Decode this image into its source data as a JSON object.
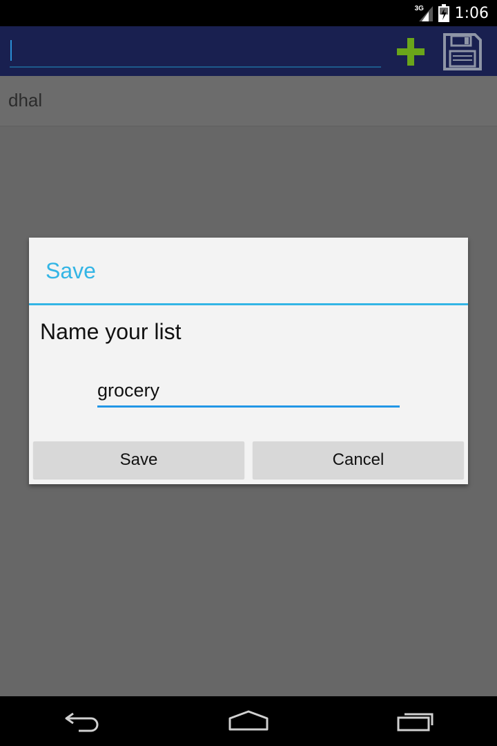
{
  "status_bar": {
    "time": "1:06",
    "network_label": "3G",
    "icons": [
      "signal-icon",
      "battery-charging-icon"
    ]
  },
  "toolbar": {
    "search_value": "",
    "add_icon": "plus-icon",
    "save_icon": "floppy-disk-icon",
    "colors": {
      "background": "#192050",
      "add_icon": "#6aa51a"
    }
  },
  "list": {
    "items": [
      {
        "label": "dhal"
      }
    ]
  },
  "dialog": {
    "title": "Save",
    "message": "Name your list",
    "input_value": "grocery",
    "save_label": "Save",
    "cancel_label": "Cancel",
    "colors": {
      "accent": "#33b5e5"
    }
  },
  "nav_bar": {
    "icons": [
      "back-icon",
      "home-icon",
      "recent-apps-icon"
    ]
  }
}
